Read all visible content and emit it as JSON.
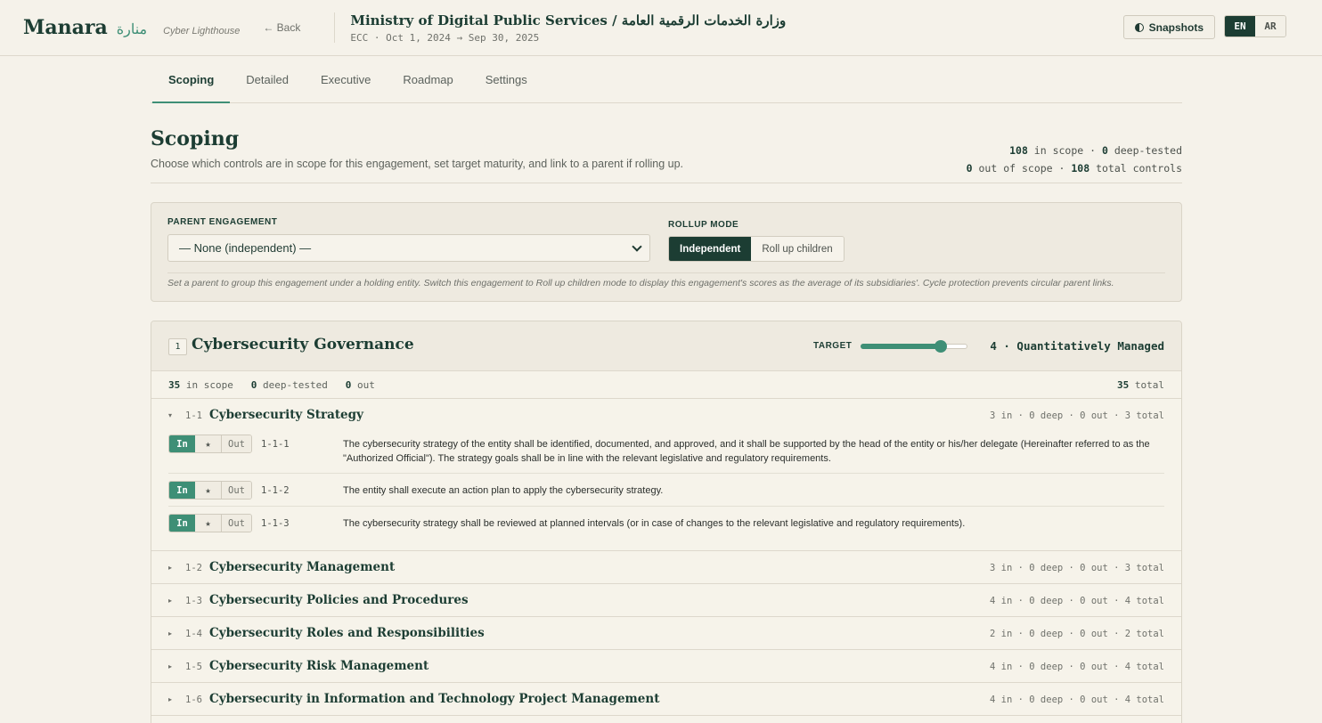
{
  "header": {
    "brand_en": "Manara",
    "brand_ar": "منارة",
    "brand_tag": "Cyber Lighthouse",
    "back_label": "← Back",
    "engagement_title": "Ministry of Digital Public Services / وزارة الخدمات الرقمية العامة",
    "engagement_sub": "ECC · Oct 1, 2024 → Sep 30, 2025",
    "snapshots_label": "Snapshots",
    "lang_en": "EN",
    "lang_ar": "AR",
    "active_lang": "EN"
  },
  "tabs": [
    {
      "label": "Scoping",
      "active": true
    },
    {
      "label": "Detailed",
      "active": false
    },
    {
      "label": "Executive",
      "active": false
    },
    {
      "label": "Roadmap",
      "active": false
    },
    {
      "label": "Settings",
      "active": false
    }
  ],
  "page": {
    "title": "Scoping",
    "subtitle": "Choose which controls are in scope for this engagement, set target maturity, and link to a parent if rolling up.",
    "in_scope": "108",
    "in_scope_label": " in scope · ",
    "deep_tested": "0",
    "deep_tested_label": " deep-tested",
    "out_of_scope": "0",
    "out_of_scope_label": " out of scope · ",
    "total": "108",
    "total_label": " total controls"
  },
  "parent": {
    "label": "PARENT ENGAGEMENT",
    "selected": "— None (independent) —",
    "rollup_label": "ROLLUP MODE",
    "mode_independent": "Independent",
    "mode_rollup": "Roll up children",
    "active_mode": "Independent",
    "note": "Set a parent to group this engagement under a holding entity. Switch this engagement to Roll up children mode to display this engagement's scores as the average of its subsidiaries'. Cycle protection prevents circular parent links."
  },
  "domain": {
    "number": "1",
    "title": "Cybersecurity Governance",
    "target_label": "TARGET",
    "target_level": 4,
    "target_max": 5,
    "target_text": "4 · Quantitatively Managed",
    "stat_in": "35",
    "stat_in_label": " in scope",
    "stat_deep": "0",
    "stat_deep_label": " deep-tested",
    "stat_out": "0",
    "stat_out_label": " out",
    "stat_total": "35",
    "stat_total_label": " total",
    "subdomains": [
      {
        "code": "1-1",
        "title": "Cybersecurity Strategy",
        "stats": "3 in · 0 deep · 0 out · 3 total",
        "expanded": true,
        "controls": [
          {
            "code": "1-1-1",
            "text": "The cybersecurity strategy of the entity shall be identified, documented, and approved, and it shall be supported by the head of the entity or his/her delegate (Hereinafter referred to as the \"Authorized Official\"). The strategy goals shall be in line with the relevant legislative and regulatory requirements.",
            "state": "In"
          },
          {
            "code": "1-1-2",
            "text": "The entity shall execute an action plan to apply the cybersecurity strategy.",
            "state": "In"
          },
          {
            "code": "1-1-3",
            "text": "The cybersecurity strategy shall be reviewed at planned intervals (or in case of changes to the relevant legislative and regulatory requirements).",
            "state": "In"
          }
        ]
      },
      {
        "code": "1-2",
        "title": "Cybersecurity Management",
        "stats": "3 in · 0 deep · 0 out · 3 total",
        "expanded": false
      },
      {
        "code": "1-3",
        "title": "Cybersecurity Policies and Procedures",
        "stats": "4 in · 0 deep · 0 out · 4 total",
        "expanded": false
      },
      {
        "code": "1-4",
        "title": "Cybersecurity Roles and Responsibilities",
        "stats": "2 in · 0 deep · 0 out · 2 total",
        "expanded": false
      },
      {
        "code": "1-5",
        "title": "Cybersecurity Risk Management",
        "stats": "4 in · 0 deep · 0 out · 4 total",
        "expanded": false
      },
      {
        "code": "1-6",
        "title": "Cybersecurity in Information and Technology Project Management",
        "stats": "4 in · 0 deep · 0 out · 4 total",
        "expanded": false
      }
    ],
    "tri_in": "In",
    "tri_star": "★",
    "tri_out": "Out",
    "caret_open": "▾",
    "caret_closed": "▸"
  }
}
